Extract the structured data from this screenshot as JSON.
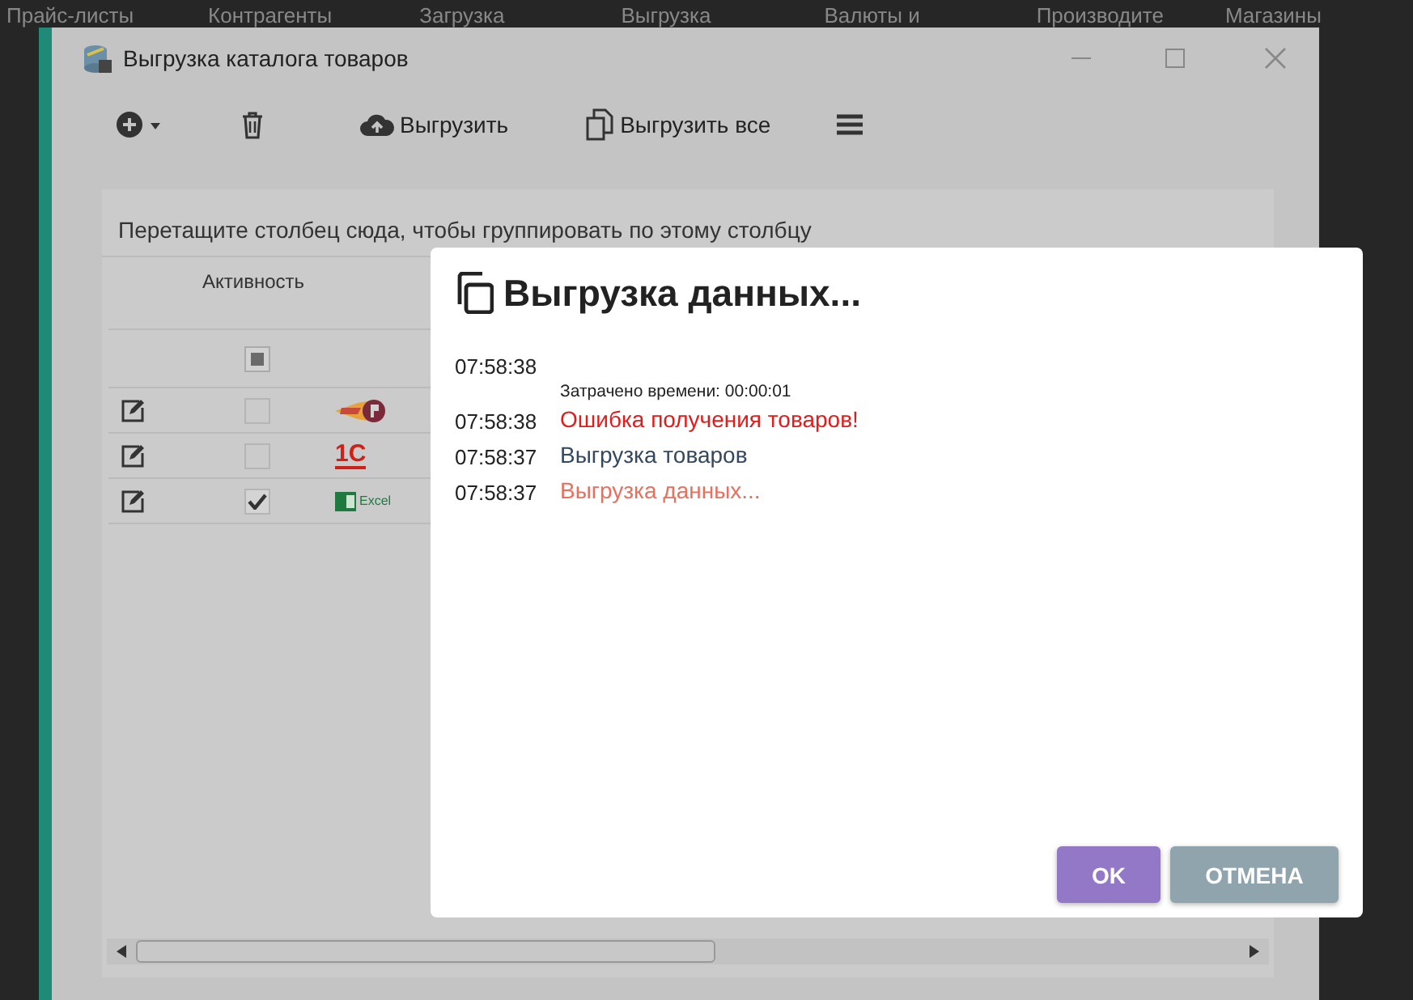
{
  "top_menu": [
    "Прайс-листы",
    "Контрагенты",
    "Загрузка",
    "Выгрузка",
    "Валюты и",
    "Производите",
    "Магазины"
  ],
  "window": {
    "title": "Выгрузка каталога товаров"
  },
  "toolbar": [
    {
      "kind": "add"
    },
    {
      "kind": "delete"
    },
    {
      "kind": "upload",
      "label": "Выгрузить"
    },
    {
      "kind": "upload_all",
      "label": "Выгрузить все"
    },
    {
      "kind": "menu"
    }
  ],
  "grid": {
    "group_hint": "Перетащите столбец сюда, чтобы группировать по этому столбцу",
    "columns": [
      "Активность"
    ],
    "filter": {
      "indeterminate": true
    },
    "rows": [
      {
        "checked": false,
        "kind": "flame"
      },
      {
        "checked": false,
        "kind": "onec",
        "logo_text": "1С"
      },
      {
        "checked": true,
        "kind": "excel",
        "logo_text": "Excel"
      }
    ]
  },
  "dialog": {
    "title": "Выгрузка данных...",
    "log": [
      {
        "time": "07:58:38",
        "text": "Затрачено времени: 00:00:01",
        "kind": "summary"
      },
      {
        "time": "07:58:38",
        "text": "Ошибка получения товаров!",
        "kind": "error"
      },
      {
        "time": "07:58:37",
        "text": "Выгрузка товаров",
        "kind": "info"
      },
      {
        "time": "07:58:37",
        "text": "Выгрузка данных...",
        "kind": "progress"
      }
    ],
    "buttons": [
      {
        "label": "OK",
        "kind": "primary"
      },
      {
        "label": "ОТМЕНА",
        "kind": "secondary"
      }
    ]
  }
}
